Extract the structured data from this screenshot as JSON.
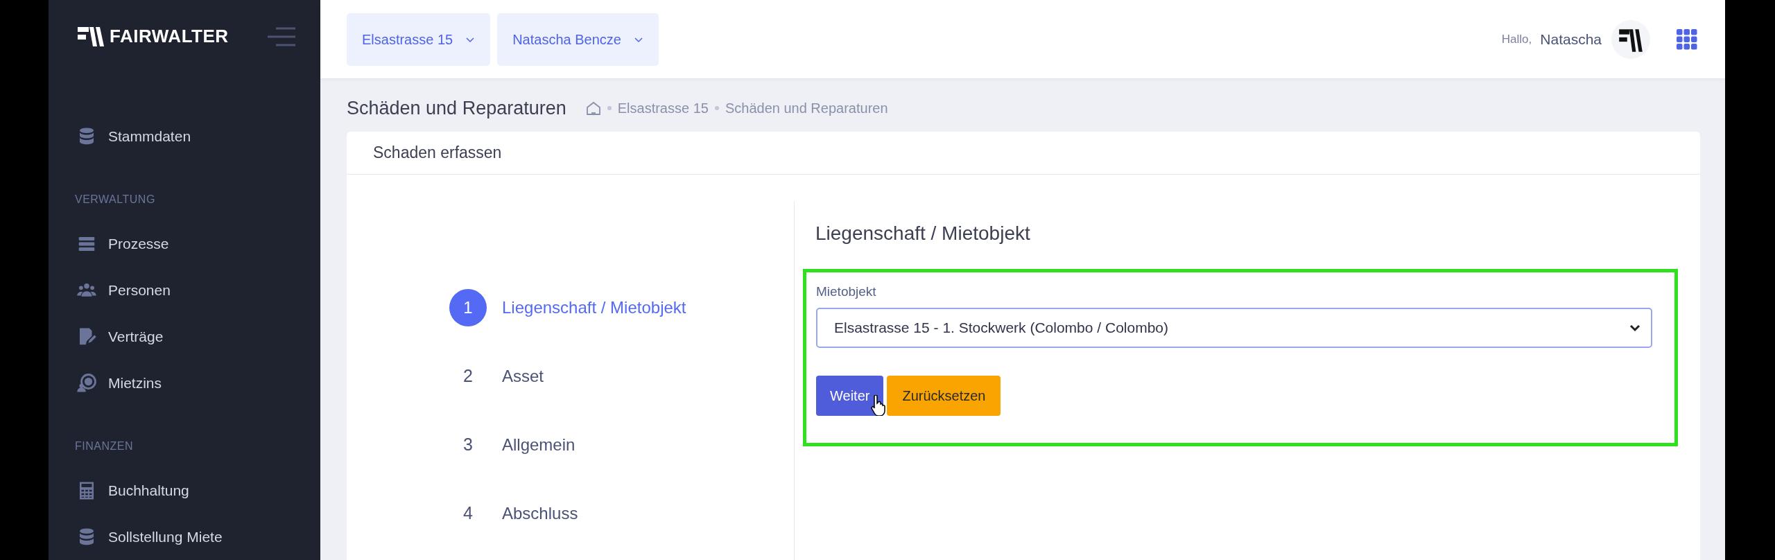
{
  "sidebar": {
    "logo": "FAIRWALTER",
    "items": [
      {
        "kind": "item",
        "label": "Stammdaten"
      },
      {
        "kind": "section",
        "label": "VERWALTUNG"
      },
      {
        "kind": "item",
        "label": "Prozesse"
      },
      {
        "kind": "item",
        "label": "Personen"
      },
      {
        "kind": "item",
        "label": "Verträge"
      },
      {
        "kind": "item",
        "label": "Mietzins"
      },
      {
        "kind": "section",
        "label": "FINANZEN"
      },
      {
        "kind": "item",
        "label": "Buchhaltung"
      },
      {
        "kind": "item",
        "label": "Sollstellung Miete"
      }
    ]
  },
  "topbar": {
    "dropdowns": [
      "Elsastrasse 15",
      "Natascha Bencze"
    ],
    "greeting": "Hallo,",
    "user": "Natascha"
  },
  "page": {
    "title": "Schäden und Reparaturen",
    "breadcrumb": [
      "Elsastrasse 15",
      "Schäden und Reparaturen"
    ]
  },
  "card": {
    "title": "Schaden erfassen",
    "steps": [
      {
        "number": "1",
        "label": "Liegenschaft / Mietobjekt",
        "selected": true
      },
      {
        "number": "2",
        "label": "Asset",
        "selected": false
      },
      {
        "number": "3",
        "label": "Allgemein",
        "selected": false
      },
      {
        "number": "4",
        "label": "Abschluss",
        "selected": false
      }
    ],
    "section_title": "Liegenschaft / Mietobjekt",
    "field": {
      "label": "Mietobjekt",
      "value": "Elsastrasse 15 - 1. Stockwerk (Colombo / Colombo)"
    },
    "buttons": [
      {
        "kind": "primary",
        "label": "Weiter"
      },
      {
        "kind": "warning",
        "label": "Zurücksetzen"
      }
    ]
  }
}
